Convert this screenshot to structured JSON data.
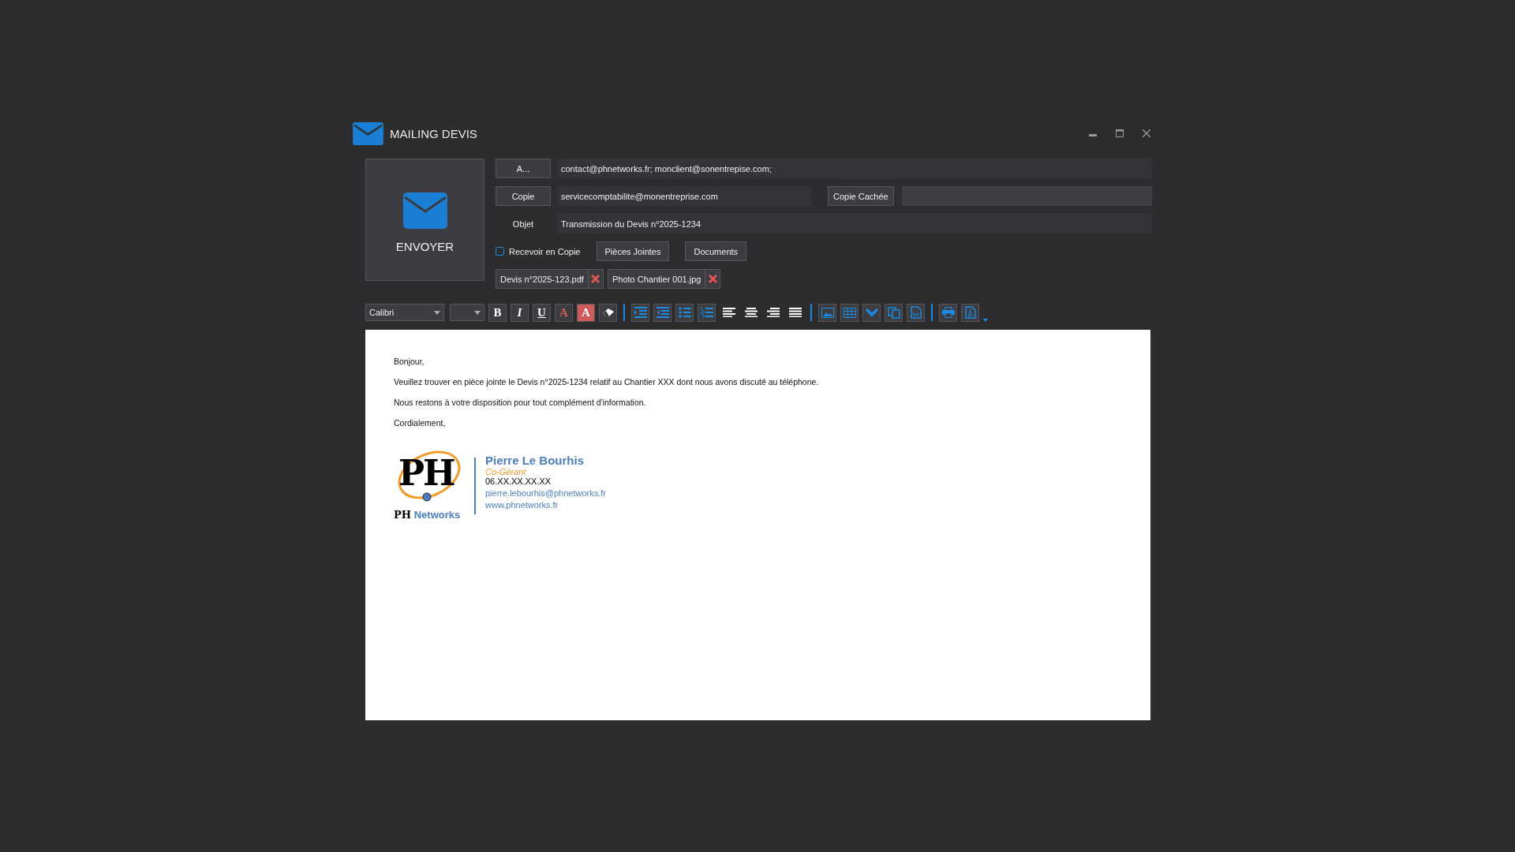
{
  "window": {
    "title": "MAILING DEVIS"
  },
  "send_button": {
    "label": "ENVOYER"
  },
  "to": {
    "button": "A...",
    "value": "contact@phnetworks.fr; monclient@sonentrepise.com;"
  },
  "cc": {
    "button": "Copie",
    "value": "servicecomptabilite@monentreprise.com"
  },
  "bcc": {
    "button": "Copie Cachée"
  },
  "subject": {
    "label": "Objet",
    "value": "Transmission du Devis n°2025-1234"
  },
  "receive_copy": {
    "label": "Recevoir en Copie",
    "checked": false
  },
  "buttons": [
    "Pièces Jointes",
    "Documents"
  ],
  "attachments": [
    {
      "name": "Devis n°2025-123.pdf"
    },
    {
      "name": "Photo Chantier 001.jpg"
    }
  ],
  "toolbar": {
    "font": "Calibri",
    "format_buttons": [
      {
        "label": "B",
        "kind": "bold"
      },
      {
        "label": "I",
        "kind": "italic"
      },
      {
        "label": "U",
        "kind": "underline"
      },
      {
        "label": "A",
        "kind": "font-color"
      },
      {
        "label": "A",
        "kind": "highlight"
      }
    ]
  },
  "body": {
    "paragraphs": [
      "Bonjour,",
      "Veuillez trouver en pièce jointe le Devis n°2025-1234 relatif au Chantier XXX dont nous avons discuté au téléphone.",
      "Nous restons à votre disposition pour tout complément d'information.",
      "Cordialement,"
    ]
  },
  "signature": {
    "logo_letters": "PH",
    "logo_caption_bold": "PH",
    "logo_caption": "Networks",
    "name": "Pierre Le Bourhis",
    "role": "Co-Gérant",
    "phone": "06.XX.XX.XX.XX",
    "email": "pierre.lebourhis@phnetworks.fr",
    "website": "www.phnetworks.fr"
  }
}
